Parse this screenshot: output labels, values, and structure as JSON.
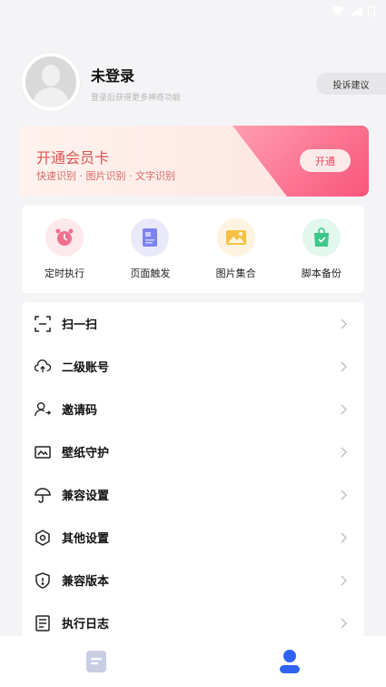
{
  "profile": {
    "name": "未登录",
    "subtitle": "登录后获得更多神奇功能",
    "feedback_label": "投诉建议"
  },
  "vip": {
    "title": "开通会员卡",
    "subtitle": "快速识别 · 图片识别 · 文字识别",
    "button_label": "开通"
  },
  "quick_actions": [
    {
      "label": "定时执行",
      "icon": "alarm-clock-icon"
    },
    {
      "label": "页面触发",
      "icon": "page-icon"
    },
    {
      "label": "图片集合",
      "icon": "image-icon"
    },
    {
      "label": "脚本备份",
      "icon": "backup-bag-icon"
    }
  ],
  "menu": [
    {
      "label": "扫一扫",
      "icon": "scan-icon"
    },
    {
      "label": "二级账号",
      "icon": "cloud-upload-icon"
    },
    {
      "label": "邀请码",
      "icon": "user-invite-icon"
    },
    {
      "label": "壁纸守护",
      "icon": "wallpaper-icon"
    },
    {
      "label": "兼容设置",
      "icon": "umbrella-icon"
    },
    {
      "label": "其他设置",
      "icon": "hexagon-settings-icon"
    },
    {
      "label": "兼容版本",
      "icon": "shield-icon"
    },
    {
      "label": "执行日志",
      "icon": "log-icon"
    }
  ],
  "nav": [
    {
      "icon": "document-tab-icon",
      "active": false
    },
    {
      "icon": "profile-tab-icon",
      "active": true
    }
  ],
  "colors": {
    "accent": "#2f63f4",
    "vip_text": "#e0524f",
    "vip_gradient_end": "#f9557a"
  }
}
